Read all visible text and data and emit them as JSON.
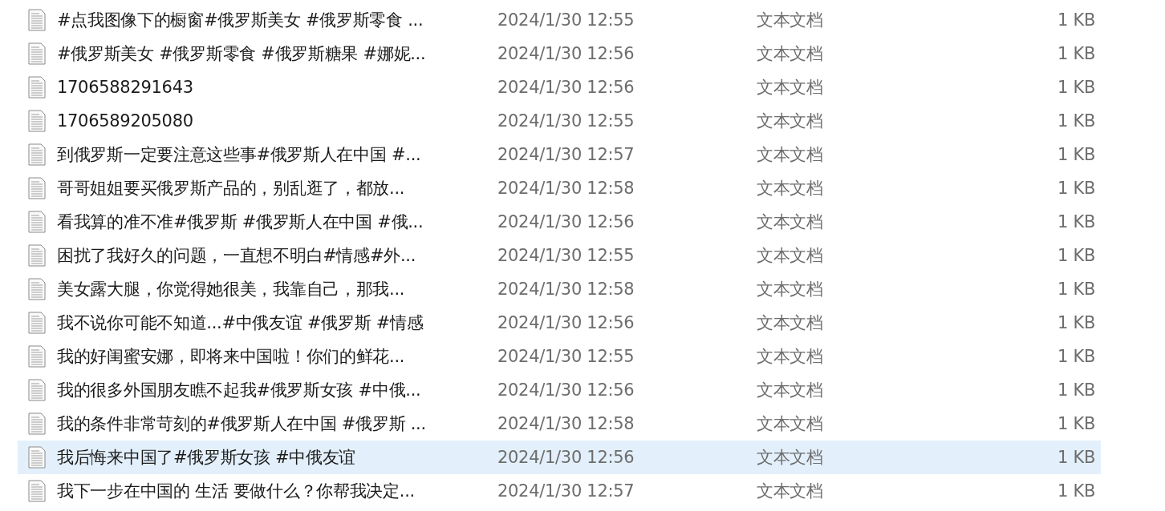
{
  "files": [
    {
      "name": "#点我图像下的橱窗#俄罗斯美女 #俄罗斯零食 ...",
      "modified": "2024/1/30 12:55",
      "type": "文本文档",
      "size": "1 KB",
      "selected": false
    },
    {
      "name": "#俄罗斯美女 #俄罗斯零食 #俄罗斯糖果 #娜妮...",
      "modified": "2024/1/30 12:56",
      "type": "文本文档",
      "size": "1 KB",
      "selected": false
    },
    {
      "name": "1706588291643",
      "modified": "2024/1/30 12:56",
      "type": "文本文档",
      "size": "1 KB",
      "selected": false
    },
    {
      "name": "1706589205080",
      "modified": "2024/1/30 12:55",
      "type": "文本文档",
      "size": "1 KB",
      "selected": false
    },
    {
      "name": "到俄罗斯一定要注意这些事#俄罗斯人在中国 #...",
      "modified": "2024/1/30 12:57",
      "type": "文本文档",
      "size": "1 KB",
      "selected": false
    },
    {
      "name": "哥哥姐姐要买俄罗斯产品的，别乱逛了，都放...",
      "modified": "2024/1/30 12:58",
      "type": "文本文档",
      "size": "1 KB",
      "selected": false
    },
    {
      "name": "看我算的准不准#俄罗斯 #俄罗斯人在中国 #俄...",
      "modified": "2024/1/30 12:56",
      "type": "文本文档",
      "size": "1 KB",
      "selected": false
    },
    {
      "name": "困扰了我好久的问题，一直想不明白#情感#外...",
      "modified": "2024/1/30 12:55",
      "type": "文本文档",
      "size": "1 KB",
      "selected": false
    },
    {
      "name": "美女露大腿，你觉得她很美，我靠自己，那我...",
      "modified": "2024/1/30 12:58",
      "type": "文本文档",
      "size": "1 KB",
      "selected": false
    },
    {
      "name": "我不说你可能不知道...#中俄友谊 #俄罗斯 #情感",
      "modified": "2024/1/30 12:56",
      "type": "文本文档",
      "size": "1 KB",
      "selected": false
    },
    {
      "name": "我的好闺蜜安娜，即将来中国啦！你们的鲜花...",
      "modified": "2024/1/30 12:55",
      "type": "文本文档",
      "size": "1 KB",
      "selected": false
    },
    {
      "name": "我的很多外国朋友瞧不起我#俄罗斯女孩 #中俄...",
      "modified": "2024/1/30 12:56",
      "type": "文本文档",
      "size": "1 KB",
      "selected": false
    },
    {
      "name": "我的条件非常苛刻的#俄罗斯人在中国 #俄罗斯 ...",
      "modified": "2024/1/30 12:58",
      "type": "文本文档",
      "size": "1 KB",
      "selected": false
    },
    {
      "name": "我后悔来中国了#俄罗斯女孩 #中俄友谊",
      "modified": "2024/1/30 12:56",
      "type": "文本文档",
      "size": "1 KB",
      "selected": true
    },
    {
      "name": "我下一步在中国的 生活 要做什么？你帮我决定...",
      "modified": "2024/1/30 12:57",
      "type": "文本文档",
      "size": "1 KB",
      "selected": false
    }
  ]
}
